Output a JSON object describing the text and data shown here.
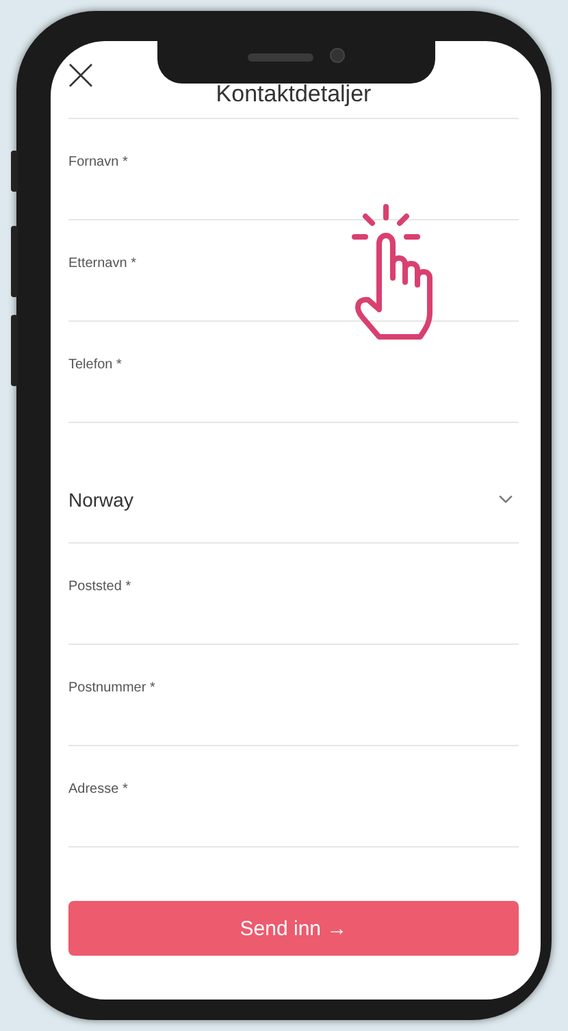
{
  "header": {
    "title": "Kontaktdetaljer"
  },
  "fields": [
    {
      "kind": "text",
      "label": "Fornavn *"
    },
    {
      "kind": "text",
      "label": "Etternavn *"
    },
    {
      "kind": "text",
      "label": "Telefon *"
    },
    {
      "kind": "select",
      "value": "Norway"
    },
    {
      "kind": "text",
      "label": "Poststed *"
    },
    {
      "kind": "text",
      "label": "Postnummer *"
    },
    {
      "kind": "text",
      "label": "Adresse *"
    }
  ],
  "submit": {
    "label": "Send inn →"
  }
}
